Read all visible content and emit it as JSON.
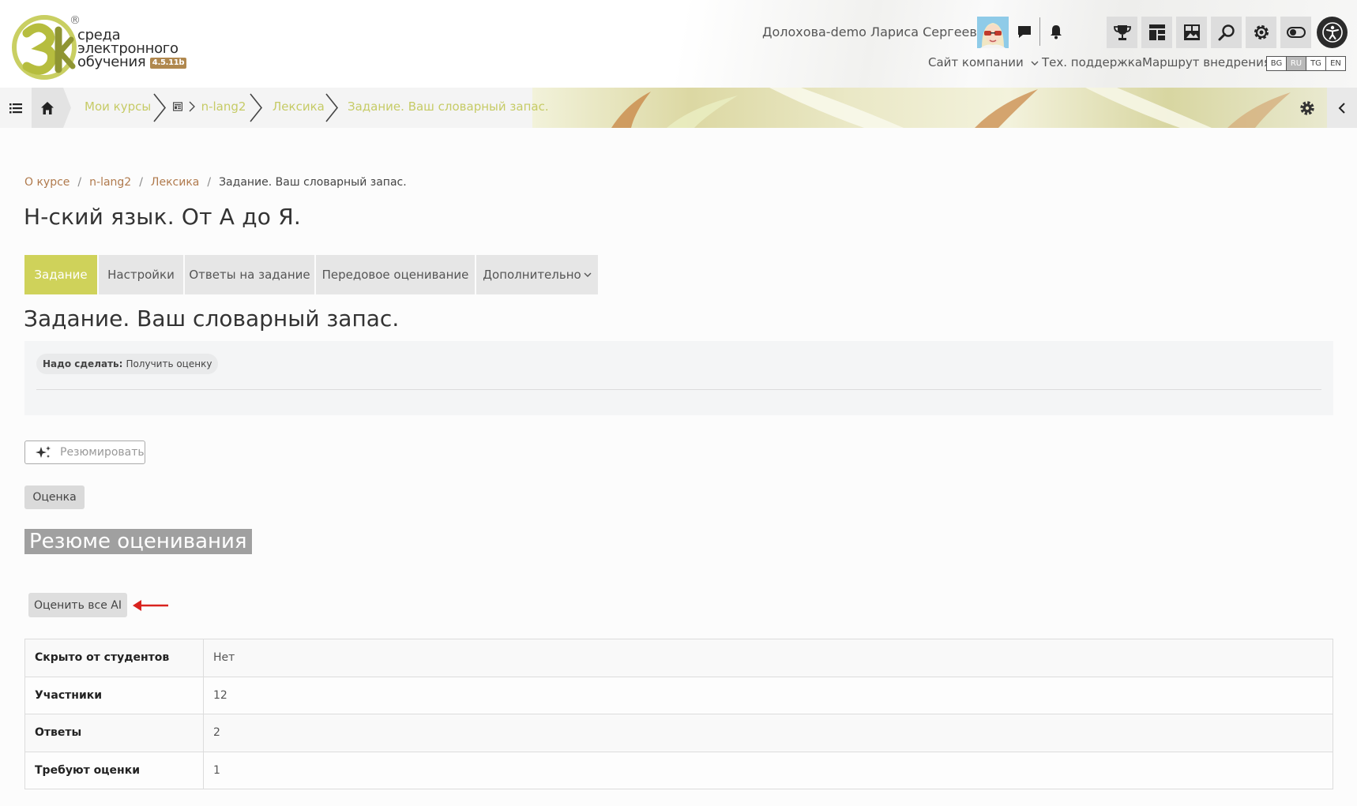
{
  "header": {
    "logo": {
      "mark": "3k",
      "line1": "среда",
      "line2": "электронного",
      "line3": "обучения",
      "version": "4.5.11b",
      "reg": "®"
    },
    "user_name": "Долохова-demo Лариса Сергеевна",
    "links": {
      "company_site": "Сайт компании",
      "tech_support": "Тех. поддержка",
      "implementation_route": "Маршрут внедрения"
    },
    "languages": [
      "BG",
      "RU",
      "TG",
      "EN"
    ],
    "active_language": "RU",
    "icons": {
      "messages": "chat-bubble-icon",
      "notifications": "bell-icon",
      "tools": [
        "trophy-icon",
        "dashboard-icon",
        "gallery-icon",
        "search-icon",
        "gear-icon",
        "toggle-icon"
      ],
      "accessibility": "accessibility-icon"
    }
  },
  "navbar": {
    "breadcrumb": {
      "my_courses": "Мои курсы",
      "course": "n-lang2",
      "section": "Лексика",
      "activity": "Задание. Ваш словарный запас."
    },
    "accent_color": "#c6cb66"
  },
  "page": {
    "breadcrumb": {
      "about": "О курсе",
      "course": "n-lang2",
      "section": "Лексика",
      "current": "Задание. Ваш словарный запас."
    },
    "course_title": "Н-ский язык. От А до Я.",
    "tabs": [
      {
        "label": "Задание",
        "active": true
      },
      {
        "label": "Настройки",
        "active": false
      },
      {
        "label": "Ответы на задание",
        "active": false
      },
      {
        "label": "Передовое оценивание",
        "active": false
      },
      {
        "label": "Дополнительно",
        "active": false
      }
    ],
    "activity_title": "Задание. Ваш словарный запас.",
    "todo": {
      "label": "Надо сделать:",
      "value": "Получить оценку"
    },
    "summarize_button": "Резюмировать",
    "grade_button": "Оценка",
    "summary_heading": "Резюме оценивания",
    "ai_grade_button": "Оценить все AI",
    "summary_table": [
      {
        "key": "Скрыто от студентов",
        "value": "Нет"
      },
      {
        "key": "Участники",
        "value": "12"
      },
      {
        "key": "Ответы",
        "value": "2"
      },
      {
        "key": "Требуют оценки",
        "value": "1"
      }
    ]
  },
  "colors": {
    "accent": "#cfd25a",
    "link": "#b07a4d",
    "arrow": "#d9231f"
  }
}
